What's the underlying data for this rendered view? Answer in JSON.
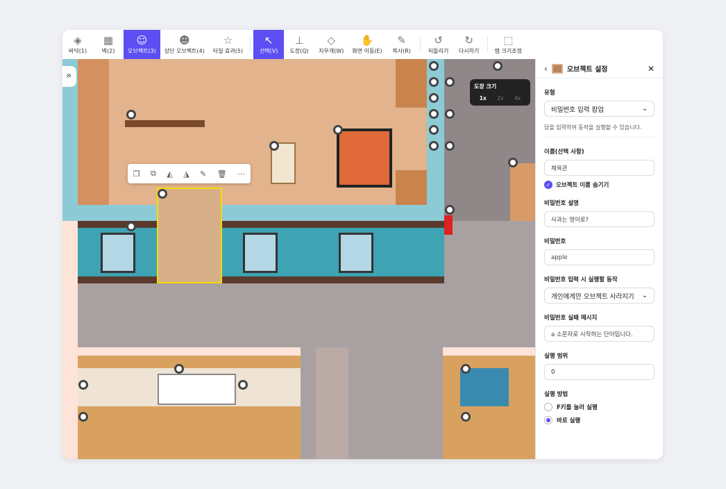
{
  "toolbar": {
    "items": [
      {
        "label": "바닥(1)",
        "icon": "layers-icon"
      },
      {
        "label": "벽(2)",
        "icon": "brick-wall-icon"
      },
      {
        "label": "오브젝트(3)",
        "icon": "object-icon",
        "active": true
      },
      {
        "label": "상단 오브젝트(4)",
        "icon": "top-object-icon"
      },
      {
        "label": "타일 효과(5)",
        "icon": "tile-effect-icon"
      },
      {
        "label": "선택(V)",
        "icon": "cursor-icon",
        "active": true
      },
      {
        "label": "도장(Q)",
        "icon": "stamp-icon"
      },
      {
        "label": "지우개(W)",
        "icon": "eraser-icon"
      },
      {
        "label": "화면 이동(E)",
        "icon": "hand-icon"
      },
      {
        "label": "복사(R)",
        "icon": "eyedropper-icon"
      },
      {
        "label": "되돌리기",
        "icon": "undo-icon"
      },
      {
        "label": "다시하기",
        "icon": "redo-icon"
      },
      {
        "label": "맵 크기조정",
        "icon": "resize-icon"
      }
    ]
  },
  "accent": "#5c4ef2",
  "stamp_size": {
    "title": "도장 크기",
    "options": [
      "1x",
      "2x",
      "4x"
    ],
    "selected": "1x"
  },
  "panel": {
    "title": "오브젝트 설정",
    "type_label": "유형",
    "type_value": "비밀번호 입력 팝업",
    "type_hint": "답을 입력하여 동작을 실행할 수 있습니다.",
    "name_label": "이름(선택 사항)",
    "name_value": "체육관",
    "hide_name_label": "오브젝트 이름 숨기기",
    "hide_name_checked": true,
    "pw_desc_label": "비밀번호 설명",
    "pw_desc_value": "사과는 영어로?",
    "pw_label": "비밀번호",
    "pw_value": "apple",
    "action_label": "비밀번호 입력 시 실행할 동작",
    "action_value": "개인에게만 오브젝트 사라지기",
    "fail_label": "비밀번호 실패 메시지",
    "fail_value": "a 소문자로 시작하는 단어입니다.",
    "range_label": "실행 범위",
    "range_value": "0",
    "method_label": "실행 방법",
    "methods": [
      "F키를 눌러 실행",
      "바로 실행"
    ],
    "method_selected": "바로 실행"
  }
}
